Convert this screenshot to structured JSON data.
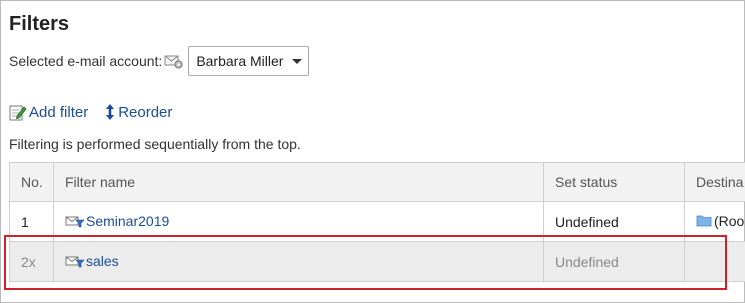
{
  "page": {
    "title": "Filters"
  },
  "account": {
    "label": "Selected e-mail account:",
    "selected": "Barbara Miller"
  },
  "actions": {
    "add_filter": "Add filter",
    "reorder": "Reorder"
  },
  "note": "Filtering is performed sequentially from the top.",
  "table": {
    "headers": {
      "no": "No.",
      "name": "Filter name",
      "status": "Set status",
      "dest": "Destina"
    },
    "rows": [
      {
        "no": "1",
        "name": "Seminar2019",
        "status": "Undefined",
        "dest": "(Roo"
      },
      {
        "no": "2x",
        "name": "sales",
        "status": "Undefined",
        "dest": ""
      }
    ]
  },
  "colors": {
    "link": "#1a4d99",
    "highlight": "#d0202a",
    "header_bg": "#f2f2f2",
    "disabled_row_bg": "#ececec"
  }
}
